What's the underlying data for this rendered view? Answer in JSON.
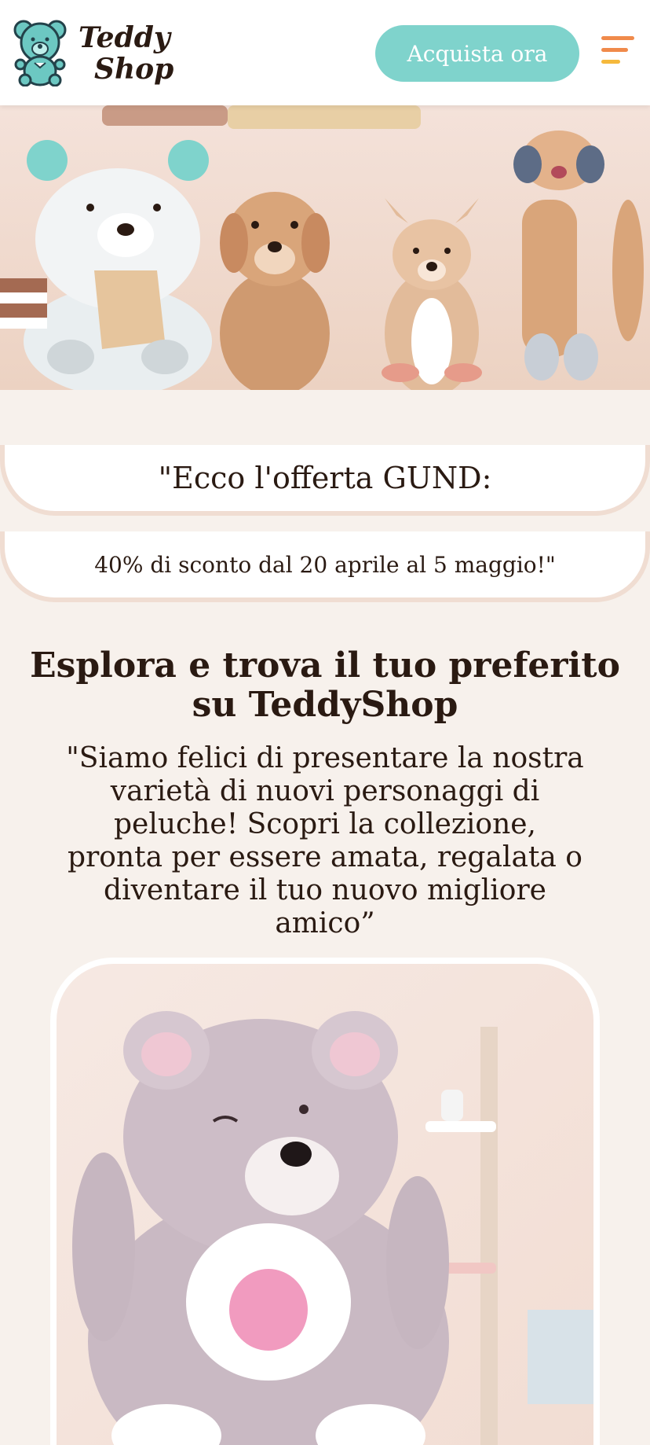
{
  "header": {
    "logo_line1": "Teddy",
    "logo_line2": "Shop",
    "cta_label": "Acquista ora",
    "menu_icon": "hamburger-menu-icon"
  },
  "offer": {
    "line1": "\"Ecco l'offerta GUND:",
    "line2": "40% di sconto dal 20 aprile al 5 maggio!\""
  },
  "section": {
    "title": "Esplora e trova il tuo preferito su TeddyShop",
    "description": "\"Siamo felici di presentare la nostra varietà di nuovi personaggi di peluche! Scopri la collezione, pronta per essere amata, regalata o diventare il tuo nuovo migliore amico”"
  },
  "colors": {
    "accent": "#7fd3cc",
    "background": "#f7f1ec",
    "menu_orange": "#f08a4b",
    "menu_yellow": "#f5b93c"
  }
}
